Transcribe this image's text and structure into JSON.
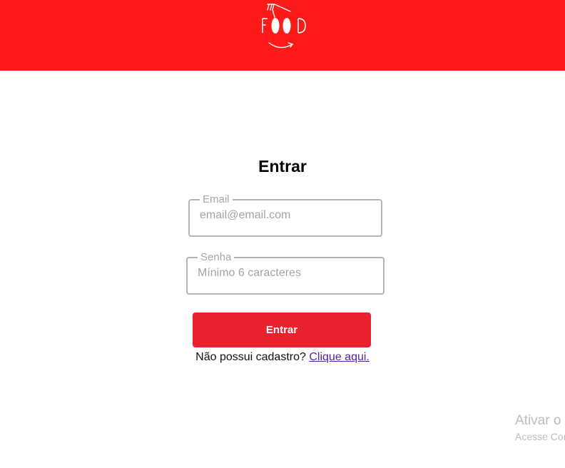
{
  "header": {
    "logo_text": "FOOD",
    "background_color": "#ff1a1a"
  },
  "form": {
    "title": "Entrar",
    "email": {
      "label": "Email",
      "placeholder": "email@email.com",
      "value": ""
    },
    "password": {
      "label": "Senha",
      "placeholder": "Mínimo 6 caracteres",
      "value": ""
    },
    "submit_label": "Entrar",
    "submit_color": "#e8222f",
    "signup_prompt": "Não possui cadastro?",
    "signup_link": "Clique aqui."
  },
  "watermark": {
    "line1": "Ativar o",
    "line2": "Acesse Con"
  }
}
